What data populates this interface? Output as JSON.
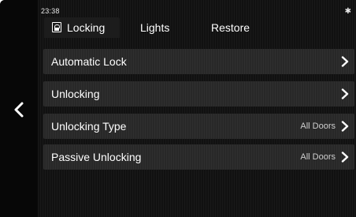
{
  "status_bar": {
    "time": "23:38",
    "bluetooth_icon": "bluetooth-icon"
  },
  "tabs": [
    {
      "label": "Locking",
      "icon": "lock-icon",
      "active": true
    },
    {
      "label": "Lights",
      "active": false
    },
    {
      "label": "Restore",
      "active": false
    }
  ],
  "nav": {
    "back_icon": "chevron-left-icon"
  },
  "menu": {
    "items": [
      {
        "label": "Automatic Lock",
        "value": ""
      },
      {
        "label": "Unlocking",
        "value": ""
      },
      {
        "label": "Unlocking Type",
        "value": "All Doors"
      },
      {
        "label": "Passive Unlocking",
        "value": "All Doors"
      }
    ]
  },
  "colors": {
    "background": "#111111",
    "row_background": "#282828",
    "text": "#ffffff",
    "value_text": "#cfcfcf"
  }
}
